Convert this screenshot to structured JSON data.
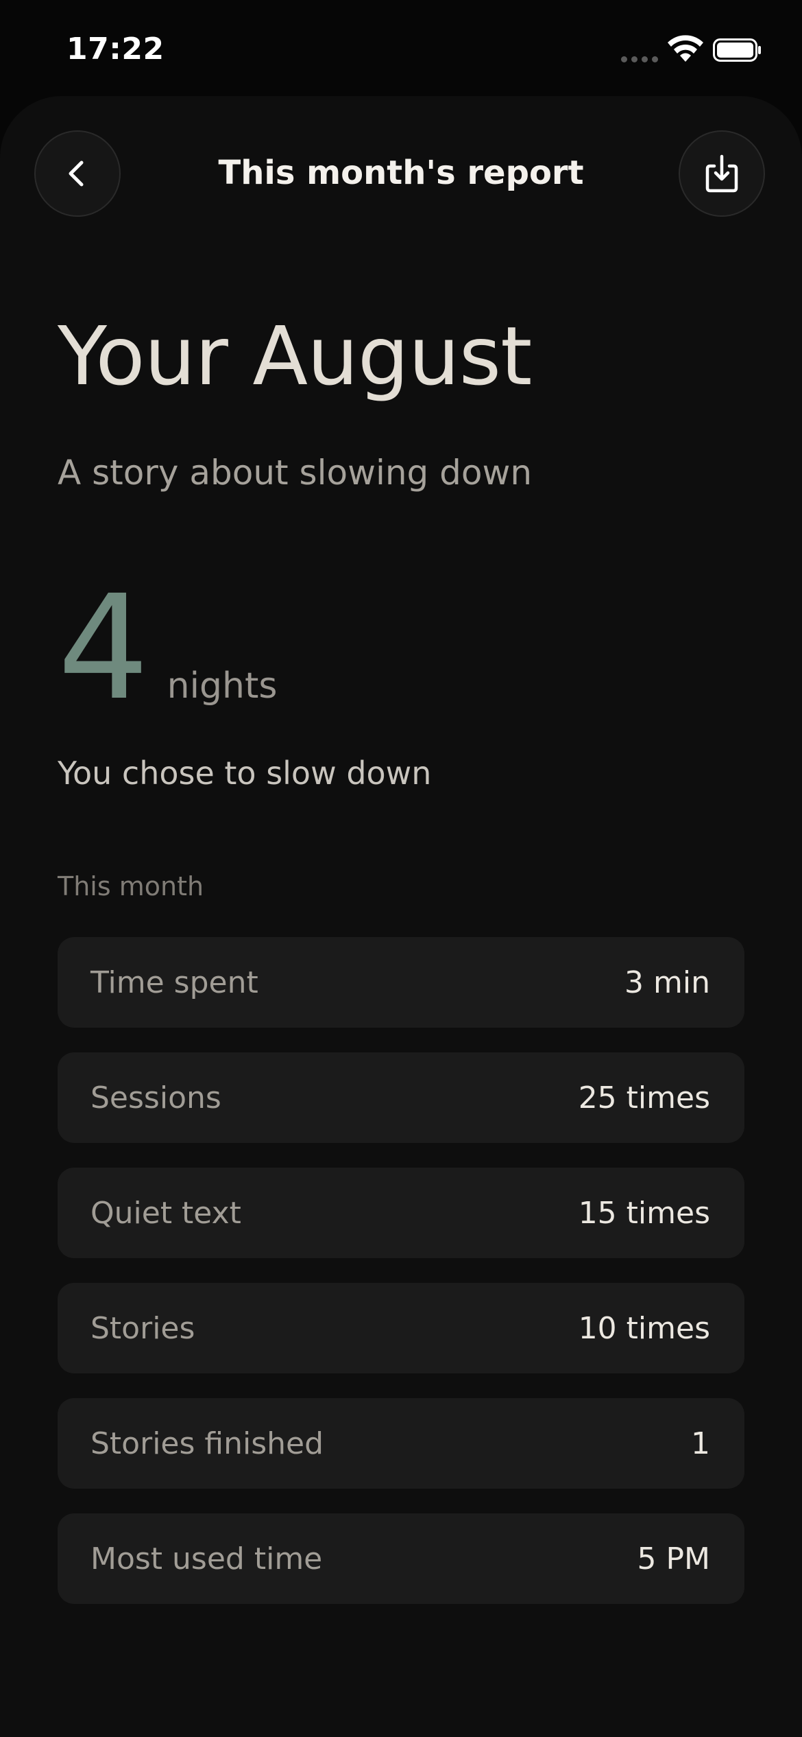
{
  "status_bar": {
    "time": "17:22",
    "icons": [
      "cellular-signal-icon",
      "wifi-icon",
      "battery-icon"
    ]
  },
  "header": {
    "title": "This month's report",
    "back_icon": "chevron-left-icon",
    "export_icon": "download-tray-icon"
  },
  "hero": {
    "title": "Your August",
    "subtitle": "A story about slowing down"
  },
  "highlight": {
    "number": "4",
    "unit": "nights",
    "caption": "You chose to slow down"
  },
  "stats": {
    "section_label": "This month",
    "rows": [
      {
        "label": "Time spent",
        "value": "3 min"
      },
      {
        "label": "Sessions",
        "value": "25 times"
      },
      {
        "label": "Quiet text",
        "value": "15 times"
      },
      {
        "label": "Stories",
        "value": "10 times"
      },
      {
        "label": "Stories finished",
        "value": "1"
      },
      {
        "label": "Most used time",
        "value": "5 PM"
      }
    ]
  },
  "colors": {
    "background": "#0e0e0e",
    "card": "#1b1b1b",
    "accent": "#6f8a7e",
    "text_primary": "#e3ded5",
    "text_secondary": "#a19d96"
  }
}
